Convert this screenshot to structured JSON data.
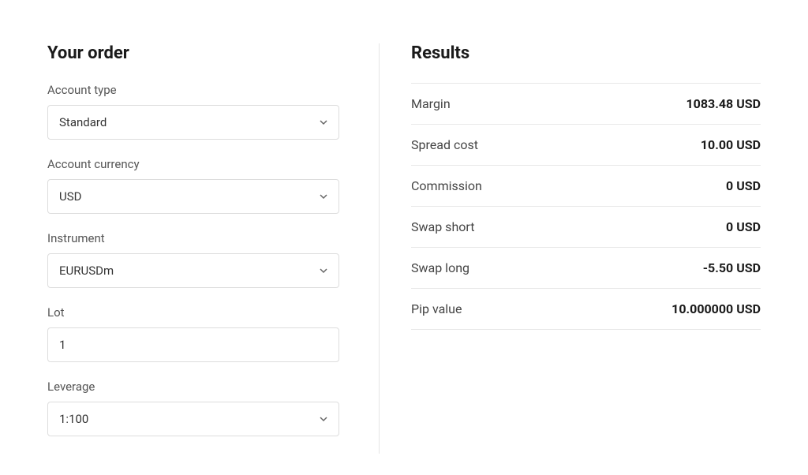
{
  "order": {
    "title": "Your order",
    "fields": {
      "account_type": {
        "label": "Account type",
        "value": "Standard"
      },
      "account_currency": {
        "label": "Account currency",
        "value": "USD"
      },
      "instrument": {
        "label": "Instrument",
        "value": "EURUSDm"
      },
      "lot": {
        "label": "Lot",
        "value": "1"
      },
      "leverage": {
        "label": "Leverage",
        "value": "1:100"
      }
    }
  },
  "results": {
    "title": "Results",
    "rows": [
      {
        "label": "Margin",
        "value": "1083.48 USD"
      },
      {
        "label": "Spread cost",
        "value": "10.00 USD"
      },
      {
        "label": "Commission",
        "value": "0 USD"
      },
      {
        "label": "Swap short",
        "value": "0 USD"
      },
      {
        "label": "Swap long",
        "value": "-5.50 USD"
      },
      {
        "label": "Pip value",
        "value": "10.000000 USD"
      }
    ]
  }
}
